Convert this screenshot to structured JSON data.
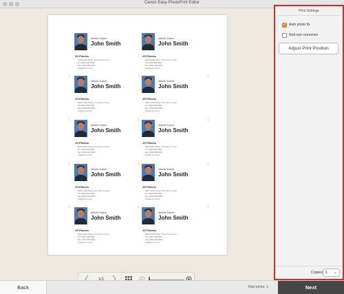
{
  "window": {
    "title": "Canon Easy-PhotoPrint Editor"
  },
  "card": {
    "role": "Athletic Trainer",
    "name": "John Smith",
    "company": "JS Fitness",
    "address": "1001 Smith Street, Your City, xx-xxxx",
    "phone": "Tel: (000) 000-0000",
    "fax": "Fax: (000) 000-0000",
    "email": "xxx@xxxx.xx.xxx"
  },
  "viewbar": {
    "page_indicator": "1/1",
    "icons": [
      "prev-page-icon",
      "next-page-icon",
      "grid-view-icon",
      "zoom-out-icon",
      "zoom-slider",
      "zoom-in-icon"
    ]
  },
  "print_settings": {
    "header": "Print Settings",
    "auto_photo_fix": {
      "label": "Auto photo fix",
      "checked": true
    },
    "red_eye_correction": {
      "label": "Red-eye correction",
      "checked": false
    },
    "adjust_button": "Adjust Print Position",
    "copies_label": "Copies",
    "copies_value": "1"
  },
  "footer": {
    "back_label": "Back",
    "total_prints": "Total prints: 1",
    "next_label": "Next"
  },
  "colors": {
    "highlight_border": "#e0252b",
    "checkbox_accent": "#f08a24",
    "next_button": "#474747"
  }
}
